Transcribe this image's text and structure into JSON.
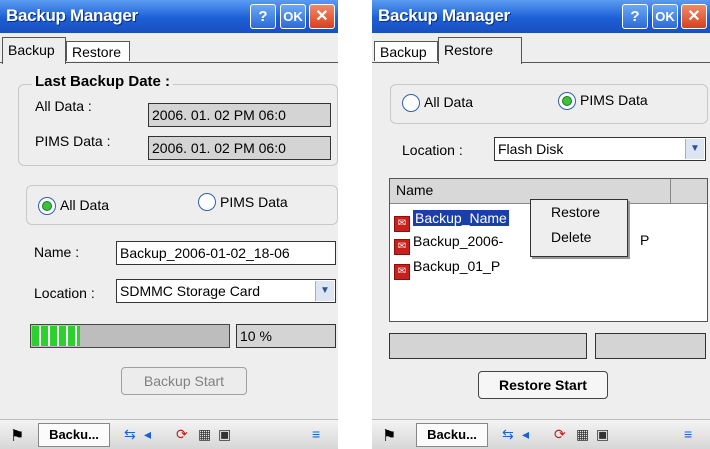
{
  "left": {
    "title": "Backup Manager",
    "title_buttons": {
      "help": "?",
      "ok": "OK",
      "close": "✕"
    },
    "tabs": [
      "Backup",
      "Restore"
    ],
    "last_backup": {
      "heading": "Last Backup Date :",
      "all_data_label": "All Data :",
      "all_data_value": "2006. 01. 02 PM 06:0",
      "pims_label": "PIMS Data :",
      "pims_value": "2006. 01. 02 PM 06:0"
    },
    "options": {
      "all_data": "All Data",
      "pims_data": "PIMS Data",
      "selected": "All Data"
    },
    "name_label": "Name :",
    "name_value": "Backup_2006-01-02_18-06",
    "location_label": "Location :",
    "location_value": "SDMMC Storage Card",
    "progress_percent": 10,
    "progress_text": "10 %",
    "start_button": "Backup Start",
    "taskbar_item": "Backu..."
  },
  "right": {
    "title": "Backup Manager",
    "title_buttons": {
      "help": "?",
      "ok": "OK",
      "close": "✕"
    },
    "tabs": [
      "Backup",
      "Restore"
    ],
    "options": {
      "all_data": "All Data",
      "pims_data": "PIMS Data",
      "selected": "PIMS Data"
    },
    "location_label": "Location :",
    "location_value": "Flash Disk",
    "list_header": "Name",
    "files": {
      "row1": "Backup_Name",
      "row2": "Backup_2006-",
      "row2_tail": "P",
      "row3": "Backup_01_P"
    },
    "context_menu": [
      "Restore",
      "Delete"
    ],
    "start_button": "Restore Start",
    "taskbar_item": "Backu..."
  },
  "icons": [
    "start-flag-icon",
    "network-icon",
    "volume-icon",
    "sync-icon",
    "calendar-icon",
    "input-icon",
    "file-icon"
  ]
}
